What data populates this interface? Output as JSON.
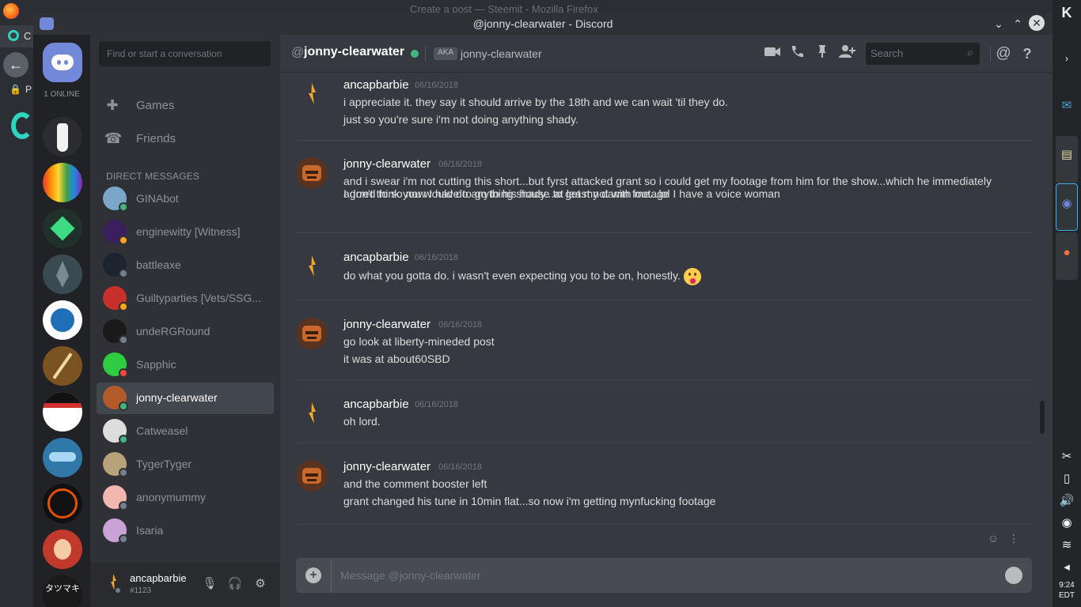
{
  "background": {
    "browser_title": "Create a post — Steemit - Mozilla Firefox",
    "tab_text": "C",
    "lock_text": "P"
  },
  "window": {
    "title": "@jonny-clearwater - Discord",
    "minimize": "⌄",
    "maximize": "⌃",
    "close": "✕"
  },
  "guilds": {
    "online_label": "1 ONLINE"
  },
  "sidebar": {
    "search_placeholder": "Find or start a conversation",
    "nav": [
      {
        "label": "Games",
        "icon": "gamepad-icon"
      },
      {
        "label": "Friends",
        "icon": "friends-icon"
      }
    ],
    "dm_header": "DIRECT MESSAGES",
    "dms": [
      {
        "name": "GINAbot",
        "status": "online",
        "status_color": "#43b581",
        "avatar_color": "#7aa7c7"
      },
      {
        "name": "enginewitty [Witness]",
        "status": "idle",
        "status_color": "#faa61a",
        "avatar_color": "#3a1f5c"
      },
      {
        "name": "battleaxe",
        "status": "offline",
        "status_color": "#747f8d",
        "avatar_color": "#1b2430"
      },
      {
        "name": "Guiltyparties [Vets/SSG...",
        "status": "idle",
        "status_color": "#faa61a",
        "avatar_color": "#c7302b"
      },
      {
        "name": "undeRGRound",
        "status": "offline",
        "status_color": "#747f8d",
        "avatar_color": "#1a1a1a"
      },
      {
        "name": "Sapphic",
        "status": "dnd",
        "status_color": "#f04747",
        "avatar_color": "#2ecc40"
      },
      {
        "name": "jonny-clearwater",
        "status": "online",
        "status_color": "#43b581",
        "avatar_color": "#b35a2a"
      },
      {
        "name": "Catweasel",
        "status": "online",
        "status_color": "#43b581",
        "avatar_color": "#dddddd"
      },
      {
        "name": "TygerTyger",
        "status": "offline",
        "status_color": "#747f8d",
        "avatar_color": "#b8a27a"
      },
      {
        "name": "anonymummy",
        "status": "offline",
        "status_color": "#747f8d",
        "avatar_color": "#f2b8b0"
      },
      {
        "name": "Isaria",
        "status": "offline",
        "status_color": "#747f8d",
        "avatar_color": "#c9a3d6"
      }
    ],
    "user": {
      "name": "ancapbarbie",
      "tag": "#1123"
    }
  },
  "chat": {
    "at": "@",
    "recipient": "jonny-clearwater",
    "aka_badge": "AKA",
    "aka_name": "jonny-clearwater",
    "search_placeholder": "Search",
    "composer_placeholder": "Message @jonny-clearwater",
    "messages": [
      {
        "author": "ancapbarbie",
        "time": "06/16/2018",
        "lines": [
          "i appreciate it. they say it should arrive by the 18th and we can wait 'til they do.",
          "just so you're sure i'm not doing anything shady."
        ]
      },
      {
        "author": "jonny-clearwater",
        "time": "06/16/2018",
        "lines": [
          "and i swear i'm not cutting this short...but fyrst attacked grant so i could get my footage from him for the show...which he immediately agrred to so now I have to go to his house to get my damn footage",
          "I don't think you would do anything shady...at least not with me...lol I have a voice woman"
        ]
      },
      {
        "author": "ancapbarbie",
        "time": "06/16/2018",
        "lines": [
          "do what you gotta do. i wasn't even expecting you to be on, honestly."
        ]
      },
      {
        "author": "jonny-clearwater",
        "time": "06/16/2018",
        "lines": [
          "go look at liberty-mineded post",
          "it was at about60SBD"
        ]
      },
      {
        "author": "ancapbarbie",
        "time": "06/16/2018",
        "lines": [
          "oh lord."
        ]
      },
      {
        "author": "jonny-clearwater",
        "time": "06/16/2018",
        "lines": [
          "and the comment booster left",
          "grant changed his tune in 10min flat...so now i'm getting mynfucking footage"
        ]
      }
    ]
  },
  "panel": {
    "clock_time": "9:24",
    "clock_zone": "EDT"
  },
  "colors": {
    "blurple": "#7289da",
    "online": "#43b581",
    "idle": "#faa61a",
    "dnd": "#f04747",
    "offline": "#747f8d"
  }
}
